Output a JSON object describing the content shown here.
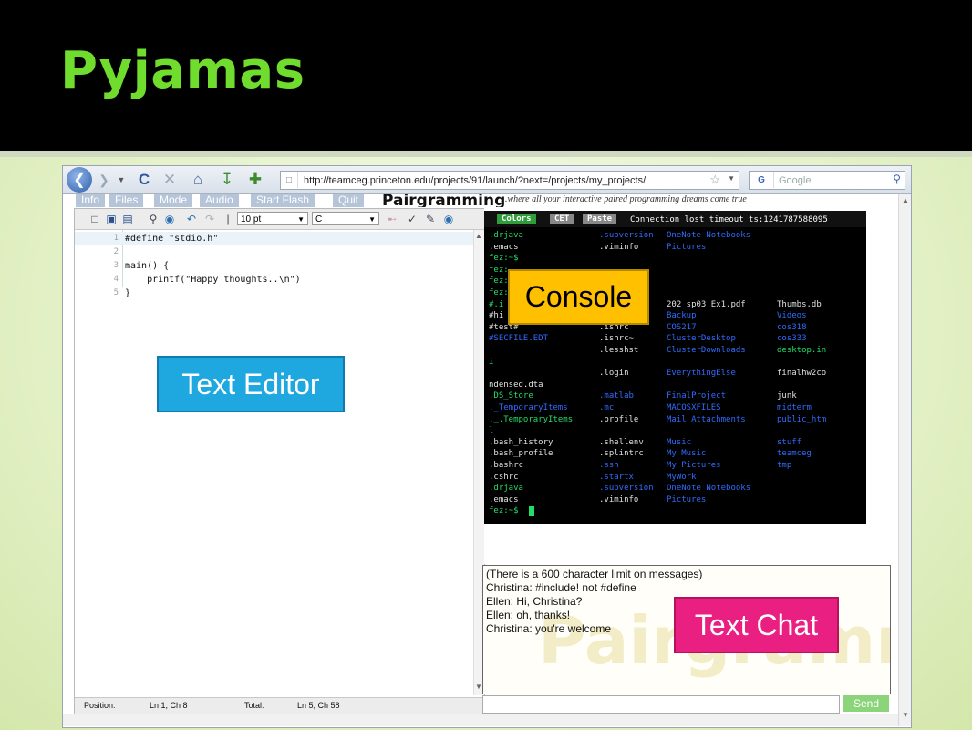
{
  "slide": {
    "title": "Pyjamas"
  },
  "browser": {
    "url": "http://teamceg.princeton.edu/projects/91/launch/?next=/projects/my_projects/",
    "search_placeholder": "Google",
    "search_engine_glyph": "G"
  },
  "app": {
    "menu": [
      "Info",
      "Files",
      "Mode",
      "Audio",
      "Start Flash",
      "Quit"
    ],
    "logo": "Pairgramming",
    "tagline": "...where all your interactive paired programming dreams come true"
  },
  "editor": {
    "font_size": "10 pt",
    "language": "C",
    "code": [
      {
        "n": "1",
        "text": "#define \"stdio.h\""
      },
      {
        "n": "2",
        "text": ""
      },
      {
        "n": "3",
        "text": "main() {"
      },
      {
        "n": "4",
        "text": "    printf(\"Happy thoughts..\\n\")"
      },
      {
        "n": "5",
        "text": "}"
      }
    ],
    "status": {
      "position_label": "Position:",
      "position_value": "Ln 1, Ch 8",
      "total_label": "Total:",
      "total_value": "Ln 5, Ch 58"
    }
  },
  "console": {
    "buttons": [
      "Colors",
      "CET",
      "Paste"
    ],
    "connection_status": "Connection lost timeout ts:1241787588095",
    "lines": [
      [
        {
          "t": ".drjava",
          "c": "g"
        },
        {
          "t": ".subversion",
          "c": "b"
        },
        {
          "t": "OneNote Notebooks",
          "c": "b"
        }
      ],
      [
        {
          "t": ".emacs",
          "c": "w"
        },
        {
          "t": ".viminfo",
          "c": "w"
        },
        {
          "t": "Pictures",
          "c": "b"
        }
      ],
      [
        {
          "t": "fez:~$",
          "c": "g"
        }
      ],
      [
        {
          "t": "fez:",
          "c": "g"
        }
      ],
      [
        {
          "t": "fez:",
          "c": "g"
        }
      ],
      [
        {
          "t": "fez:",
          "c": "g"
        }
      ],
      [
        {
          "t": "#.i",
          "c": "g"
        },
        {
          "t": "",
          "c": "w"
        },
        {
          "t": "202_sp03_Ex1.pdf",
          "c": "w"
        },
        {
          "t": "Thumbs.db",
          "c": "w"
        }
      ],
      [
        {
          "t": "#hi",
          "c": "w"
        },
        {
          "t": "",
          "c": "w"
        },
        {
          "t": "Backup",
          "c": "b"
        },
        {
          "t": "Videos",
          "c": "b"
        }
      ],
      [
        {
          "t": "#test#",
          "c": "w"
        },
        {
          "t": ".ishrc",
          "c": "w"
        },
        {
          "t": "COS217",
          "c": "b"
        },
        {
          "t": "cos318",
          "c": "b"
        }
      ],
      [
        {
          "t": "#SECFILE.EDT",
          "c": "b"
        },
        {
          "t": ".ishrc~",
          "c": "w"
        },
        {
          "t": "ClusterDesktop",
          "c": "b"
        },
        {
          "t": "cos333",
          "c": "b"
        }
      ],
      [
        {
          "t": "",
          "c": "w"
        },
        {
          "t": ".lesshst",
          "c": "w"
        },
        {
          "t": "ClusterDownloads",
          "c": "b"
        },
        {
          "t": "desktop.in",
          "c": "g"
        }
      ],
      [
        {
          "t": "i",
          "c": "g"
        }
      ],
      [
        {
          "t": "",
          "c": "w"
        },
        {
          "t": ".login",
          "c": "w"
        },
        {
          "t": "EverythingElse",
          "c": "b"
        },
        {
          "t": "finalhw2co",
          "c": "w"
        }
      ],
      [
        {
          "t": "ndensed.dta",
          "c": "w"
        }
      ],
      [
        {
          "t": ".DS_Store",
          "c": "g"
        },
        {
          "t": ".matlab",
          "c": "b"
        },
        {
          "t": "FinalProject",
          "c": "b"
        },
        {
          "t": "junk",
          "c": "w"
        }
      ],
      [
        {
          "t": "._TemporaryItems",
          "c": "b"
        },
        {
          "t": ".mc",
          "c": "b"
        },
        {
          "t": "MACOSXFILES",
          "c": "b"
        },
        {
          "t": "midterm",
          "c": "b"
        }
      ],
      [
        {
          "t": "._.TemporaryItems",
          "c": "g"
        },
        {
          "t": ".profile",
          "c": "w"
        },
        {
          "t": "Mail Attachments",
          "c": "b"
        },
        {
          "t": "public_htm",
          "c": "b"
        }
      ],
      [
        {
          "t": "l",
          "c": "b"
        }
      ],
      [
        {
          "t": ".bash_history",
          "c": "w"
        },
        {
          "t": ".shellenv",
          "c": "w"
        },
        {
          "t": "Music",
          "c": "b"
        },
        {
          "t": "stuff",
          "c": "b"
        }
      ],
      [
        {
          "t": ".bash_profile",
          "c": "w"
        },
        {
          "t": ".splintrc",
          "c": "w"
        },
        {
          "t": "My Music",
          "c": "b"
        },
        {
          "t": "teamceg",
          "c": "b"
        }
      ],
      [
        {
          "t": ".bashrc",
          "c": "w"
        },
        {
          "t": ".ssh",
          "c": "b"
        },
        {
          "t": "My Pictures",
          "c": "b"
        },
        {
          "t": "tmp",
          "c": "b"
        }
      ],
      [
        {
          "t": ".cshrc",
          "c": "w"
        },
        {
          "t": ".startx",
          "c": "b"
        },
        {
          "t": "MyWork",
          "c": "b"
        }
      ],
      [
        {
          "t": ".drjava",
          "c": "g"
        },
        {
          "t": ".subversion",
          "c": "b"
        },
        {
          "t": "OneNote Notebooks",
          "c": "b"
        }
      ],
      [
        {
          "t": ".emacs",
          "c": "w"
        },
        {
          "t": ".viminfo",
          "c": "w"
        },
        {
          "t": "Pictures",
          "c": "b"
        }
      ],
      [
        {
          "t": "fez:~$ ",
          "c": "g"
        }
      ]
    ]
  },
  "chat": {
    "watermark": "Pairgramming",
    "messages": [
      "(There is a 600 character limit on messages)",
      "Christina: #include! not #define",
      "Ellen: Hi, Christina?",
      "Ellen: oh, thanks!",
      "Christina: you're welcome"
    ],
    "send_label": "Send"
  },
  "callouts": {
    "console": "Console",
    "editor": "Text Editor",
    "chat": "Text Chat"
  },
  "colors": {
    "title_green": "#6fdc2e",
    "console_label": "#ffc000",
    "editor_label": "#1fa8e0",
    "chat_label": "#ea1f82",
    "send_button": "#8cd47a"
  }
}
